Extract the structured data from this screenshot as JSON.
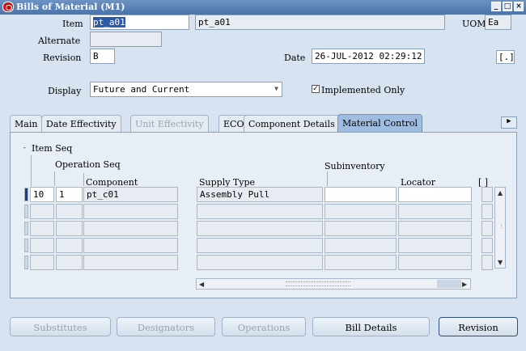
{
  "window": {
    "title": "Bills of Material (M1)"
  },
  "header": {
    "item_label": "Item",
    "item_value": "pt_a01",
    "item_desc": "pt_a01",
    "uom_label": "UOM",
    "uom_value": "Ea",
    "alternate_label": "Alternate",
    "alternate_value": "",
    "revision_label": "Revision",
    "revision_value": "B",
    "date_label": "Date",
    "date_value": "26-JUL-2012 02:29:12",
    "flex_value": "[.]",
    "display_label": "Display",
    "display_value": "Future and Current",
    "implemented_label": "Implemented Only",
    "implemented_checked": "✓"
  },
  "tabs": [
    {
      "label": "Main"
    },
    {
      "label": "Date Effectivity"
    },
    {
      "label": "Unit Effectivity"
    },
    {
      "label": "ECO"
    },
    {
      "label": "Component Details"
    },
    {
      "label": "Material Control"
    }
  ],
  "grid": {
    "item_seq_label": "Item Seq",
    "operation_seq_label": "Operation Seq",
    "component_label": "Component",
    "supply_type_label": "Supply Type",
    "subinventory_label": "Subinventory",
    "locator_label": "Locator",
    "flex_label": "[ ]",
    "rows": [
      {
        "item_seq": "10",
        "op_seq": "1",
        "component": "pt_c01",
        "supply_type": "Assembly Pull",
        "subinventory": "",
        "locator": ""
      },
      {
        "item_seq": "",
        "op_seq": "",
        "component": "",
        "supply_type": "",
        "subinventory": "",
        "locator": ""
      },
      {
        "item_seq": "",
        "op_seq": "",
        "component": "",
        "supply_type": "",
        "subinventory": "",
        "locator": ""
      },
      {
        "item_seq": "",
        "op_seq": "",
        "component": "",
        "supply_type": "",
        "subinventory": "",
        "locator": ""
      },
      {
        "item_seq": "",
        "op_seq": "",
        "component": "",
        "supply_type": "",
        "subinventory": "",
        "locator": ""
      }
    ]
  },
  "buttons": {
    "substitutes": "Substitutes",
    "designators": "Designators",
    "operations": "Operations",
    "bill_details": "Bill Details",
    "revision": "Revision"
  }
}
